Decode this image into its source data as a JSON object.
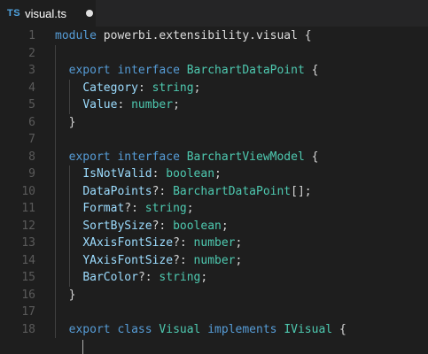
{
  "tab": {
    "icon_text": "TS",
    "filename": "visual.ts",
    "modified": true
  },
  "lines": [
    {
      "n": "1",
      "indent": 0,
      "tokens": [
        [
          "kw",
          "module"
        ],
        [
          "punc",
          " "
        ],
        [
          "id",
          "powerbi.extensibility.visual"
        ],
        [
          "punc",
          " {"
        ]
      ]
    },
    {
      "n": "2",
      "indent": 0,
      "tokens": []
    },
    {
      "n": "3",
      "indent": 2,
      "tokens": [
        [
          "kw",
          "export"
        ],
        [
          "punc",
          " "
        ],
        [
          "kw",
          "interface"
        ],
        [
          "punc",
          " "
        ],
        [
          "ty",
          "BarchartDataPoint"
        ],
        [
          "punc",
          " {"
        ]
      ]
    },
    {
      "n": "4",
      "indent": 4,
      "tokens": [
        [
          "prop",
          "Category"
        ],
        [
          "punc",
          ": "
        ],
        [
          "ty",
          "string"
        ],
        [
          "punc",
          ";"
        ]
      ]
    },
    {
      "n": "5",
      "indent": 4,
      "tokens": [
        [
          "prop",
          "Value"
        ],
        [
          "punc",
          ": "
        ],
        [
          "ty",
          "number"
        ],
        [
          "punc",
          ";"
        ]
      ]
    },
    {
      "n": "6",
      "indent": 2,
      "tokens": [
        [
          "punc",
          "}"
        ]
      ]
    },
    {
      "n": "7",
      "indent": 0,
      "tokens": []
    },
    {
      "n": "8",
      "indent": 2,
      "tokens": [
        [
          "kw",
          "export"
        ],
        [
          "punc",
          " "
        ],
        [
          "kw",
          "interface"
        ],
        [
          "punc",
          " "
        ],
        [
          "ty",
          "BarchartViewModel"
        ],
        [
          "punc",
          " {"
        ]
      ]
    },
    {
      "n": "9",
      "indent": 4,
      "tokens": [
        [
          "prop",
          "IsNotValid"
        ],
        [
          "punc",
          ": "
        ],
        [
          "ty",
          "boolean"
        ],
        [
          "punc",
          ";"
        ]
      ]
    },
    {
      "n": "10",
      "indent": 4,
      "tokens": [
        [
          "prop",
          "DataPoints"
        ],
        [
          "punc",
          "?: "
        ],
        [
          "ty",
          "BarchartDataPoint"
        ],
        [
          "punc",
          "[];"
        ]
      ]
    },
    {
      "n": "11",
      "indent": 4,
      "tokens": [
        [
          "prop",
          "Format"
        ],
        [
          "punc",
          "?: "
        ],
        [
          "ty",
          "string"
        ],
        [
          "punc",
          ";"
        ]
      ]
    },
    {
      "n": "12",
      "indent": 4,
      "tokens": [
        [
          "prop",
          "SortBySize"
        ],
        [
          "punc",
          "?: "
        ],
        [
          "ty",
          "boolean"
        ],
        [
          "punc",
          ";"
        ]
      ]
    },
    {
      "n": "13",
      "indent": 4,
      "tokens": [
        [
          "prop",
          "XAxisFontSize"
        ],
        [
          "punc",
          "?: "
        ],
        [
          "ty",
          "number"
        ],
        [
          "punc",
          ";"
        ]
      ]
    },
    {
      "n": "14",
      "indent": 4,
      "tokens": [
        [
          "prop",
          "YAxisFontSize"
        ],
        [
          "punc",
          "?: "
        ],
        [
          "ty",
          "number"
        ],
        [
          "punc",
          ";"
        ]
      ]
    },
    {
      "n": "15",
      "indent": 4,
      "tokens": [
        [
          "prop",
          "BarColor"
        ],
        [
          "punc",
          "?: "
        ],
        [
          "ty",
          "string"
        ],
        [
          "punc",
          ";"
        ]
      ]
    },
    {
      "n": "16",
      "indent": 2,
      "tokens": [
        [
          "punc",
          "}"
        ]
      ]
    },
    {
      "n": "17",
      "indent": 0,
      "tokens": []
    },
    {
      "n": "18",
      "indent": 2,
      "tokens": [
        [
          "kw",
          "export"
        ],
        [
          "punc",
          " "
        ],
        [
          "kw",
          "class"
        ],
        [
          "punc",
          " "
        ],
        [
          "ty",
          "Visual"
        ],
        [
          "punc",
          " "
        ],
        [
          "kw",
          "implements"
        ],
        [
          "punc",
          " "
        ],
        [
          "ty",
          "IVisual"
        ],
        [
          "punc",
          " {"
        ]
      ]
    }
  ],
  "colors": {
    "background": "#1e1e1e",
    "keyword": "#569cd6",
    "type": "#4ec9b0",
    "property": "#9cdcfe",
    "line_number": "#5a5a5a"
  }
}
